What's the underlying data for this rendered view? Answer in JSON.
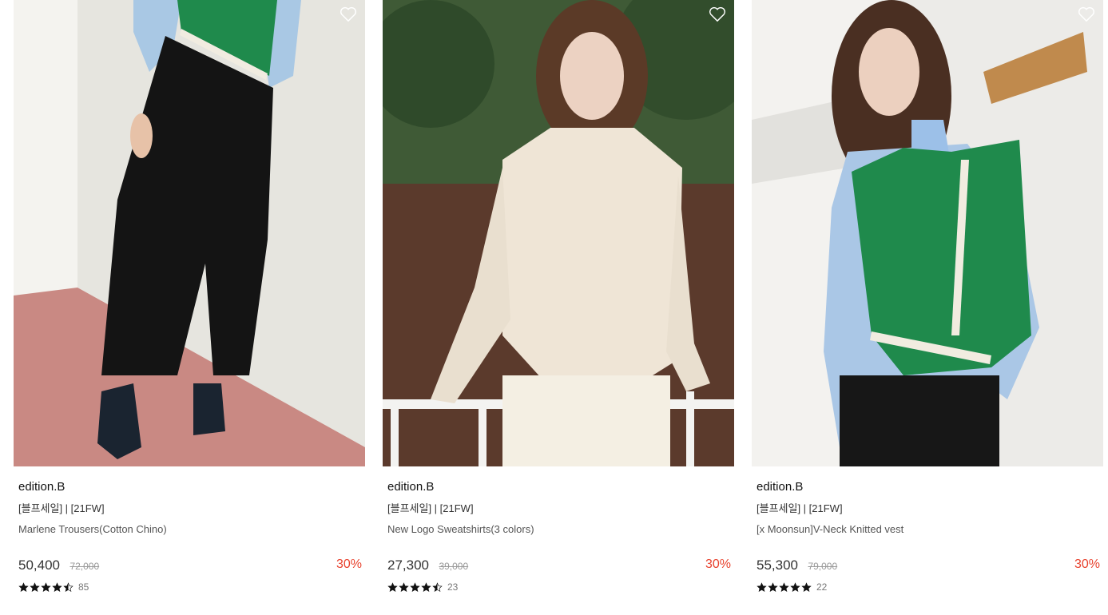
{
  "products": [
    {
      "brand": "edition.B",
      "tags": "[블프세일] | [21FW]",
      "name": "Marlene Trousers(Cotton Chino)",
      "price": "50,400",
      "original_price": "72,000",
      "discount": "30%",
      "rating": 4.5,
      "review_count": "85"
    },
    {
      "brand": "edition.B",
      "tags": "[블프세일] | [21FW]",
      "name": "New Logo Sweatshirts(3 colors)",
      "price": "27,300",
      "original_price": "39,000",
      "discount": "30%",
      "rating": 4.5,
      "review_count": "23"
    },
    {
      "brand": "edition.B",
      "tags": "[블프세일] | [21FW]",
      "name": "[x Moonsun]V-Neck Knitted vest",
      "price": "55,300",
      "original_price": "79,000",
      "discount": "30%",
      "rating": 5,
      "review_count": "22"
    }
  ],
  "colors": {
    "discount": "#e8432f",
    "price": "#333333",
    "star": "#111111"
  },
  "icons": {
    "wishlist": "heart-outline-icon",
    "rating": "star-icon"
  }
}
